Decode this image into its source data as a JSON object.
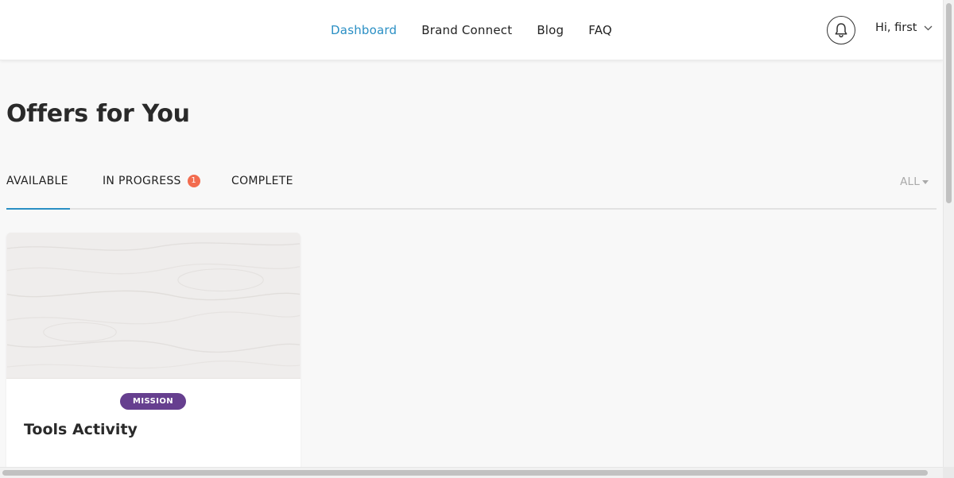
{
  "header": {
    "nav": [
      {
        "label": "Dashboard",
        "active": true
      },
      {
        "label": "Brand Connect",
        "active": false
      },
      {
        "label": "Blog",
        "active": false
      },
      {
        "label": "FAQ",
        "active": false
      }
    ],
    "notifications_icon": "bell-icon",
    "user_greeting": "Hi, first",
    "user_menu_icon": "chevron-down-icon"
  },
  "main": {
    "page_title": "Offers for You",
    "tabs": [
      {
        "label": "AVAILABLE",
        "active": true
      },
      {
        "label": "IN PROGRESS",
        "badge": "1",
        "active": false
      },
      {
        "label": "COMPLETE",
        "active": false
      }
    ],
    "filter": {
      "label": "ALL",
      "icon": "caret-down-icon"
    },
    "offers": [
      {
        "badge": "MISSION",
        "title": "Tools Activity"
      }
    ]
  },
  "colors": {
    "accent": "#2a8fc4",
    "badge_notification": "#f26c4f",
    "mission_badge": "#663f8f",
    "page_background": "#f8f8f8"
  }
}
